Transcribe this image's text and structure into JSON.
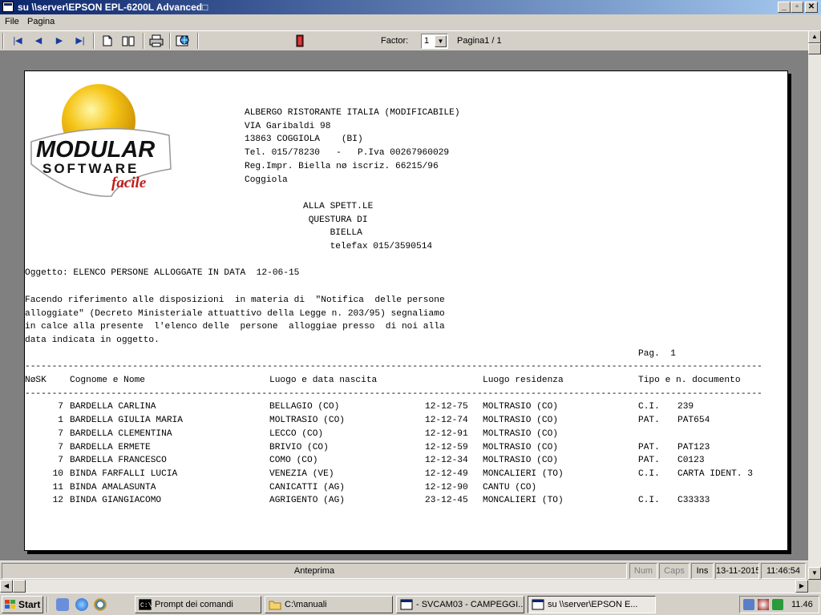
{
  "window": {
    "title": "su \\\\server\\EPSON EPL-6200L Advanced",
    "title_suffix": "□",
    "min_glyph": "_",
    "max_glyph": "▫",
    "close_glyph": "✕"
  },
  "menu": [
    "File",
    "Pagina"
  ],
  "toolbar": {
    "buttons": [
      "first-page",
      "prev-page",
      "next-page",
      "last-page",
      "single-page",
      "two-pages",
      "print",
      "export",
      "exit"
    ],
    "glyphs": {
      "first": "|◀",
      "prev": "◀",
      "next": "▶",
      "last": "▶|"
    },
    "factor_label": "Factor:",
    "factor_value": "1",
    "page_label": "Pagina1 / 1"
  },
  "logo": {
    "line1": "MODULAR",
    "line2": "SOFTWARE",
    "line3": "facile"
  },
  "document": {
    "header_lines": [
      "ALBERGO RISTORANTE ITALIA (MODIFICABILE)",
      "VIA Garibaldi 98",
      "13863 COGGIOLA    (BI)",
      "Tel. 015/78230   -   P.Iva 00267960029",
      "Reg.Impr. Biella nø iscriz. 66215/96",
      "Coggiola"
    ],
    "recipient_lines": [
      "ALLA SPETT.LE",
      " QUESTURA DI",
      "     BIELLA",
      "     telefax 015/3590514"
    ],
    "subject": "Oggetto: ELENCO PERSONE ALLOGGATE IN DATA  12-06-15",
    "body_lines": [
      "Facendo riferimento alle disposizioni  in materia di  \"Notifica  delle persone",
      "alloggiate\" (Decreto Ministeriale attuattivo della Legge n. 203/95) segnaliamo",
      "in calce alla presente  l'elenco delle  persone  alloggiae presso  di noi alla",
      "data indicata in oggetto."
    ],
    "page_number": "Pag.  1",
    "separator": "--------------------------------------------------------------------------------------------------------------------------------------------------------",
    "columns": [
      "NøSK",
      "Cognome e Nome",
      "Luogo e data nascita",
      "Luogo residenza",
      "Tipo e n. documento"
    ],
    "rows": [
      {
        "n": "7",
        "name": "BARDELLA CARLINA",
        "birthplace": "BELLAGIO (CO)",
        "date": "12-12-75",
        "residence": "MOLTRASIO (CO)",
        "doc_type": "C.I.",
        "doc_no": "239"
      },
      {
        "n": "1",
        "name": "BARDELLA GIULIA MARIA",
        "birthplace": "MOLTRASIO (CO)",
        "date": "12-12-74",
        "residence": "MOLTRASIO (CO)",
        "doc_type": "PAT.",
        "doc_no": "PAT654"
      },
      {
        "n": "7",
        "name": "BARDELLA CLEMENTINA",
        "birthplace": "LECCO (CO)",
        "date": "12-12-91",
        "residence": "MOLTRASIO (CO)",
        "doc_type": "",
        "doc_no": ""
      },
      {
        "n": "7",
        "name": "BARDELLA ERMETE",
        "birthplace": "BRIVIO (CO)",
        "date": "12-12-59",
        "residence": "MOLTRASIO (CO)",
        "doc_type": "PAT.",
        "doc_no": "PAT123"
      },
      {
        "n": "7",
        "name": "BARDELLA FRANCESCO",
        "birthplace": "COMO (CO)",
        "date": "12-12-34",
        "residence": "MOLTRASIO (CO)",
        "doc_type": "PAT.",
        "doc_no": "C0123"
      },
      {
        "n": "10",
        "name": "BINDA FARFALLI LUCIA",
        "birthplace": "VENEZIA (VE)",
        "date": "12-12-49",
        "residence": "MONCALIERI (TO)",
        "doc_type": "C.I.",
        "doc_no": "CARTA IDENT. 3"
      },
      {
        "n": "11",
        "name": "BINDA AMALASUNTA",
        "birthplace": "CANICATTI (AG)",
        "date": "12-12-90",
        "residence": "CANTU (CO)",
        "doc_type": "",
        "doc_no": ""
      },
      {
        "n": "12",
        "name": "BINDA GIANGIACOMO",
        "birthplace": "AGRIGENTO (AG)",
        "date": "23-12-45",
        "residence": "MONCALIERI (TO)",
        "doc_type": "C.I.",
        "doc_no": "C33333"
      }
    ]
  },
  "status": {
    "label": "Anteprima",
    "num": "Num",
    "caps": "Caps",
    "ins": "Ins",
    "date": "13-11-2015",
    "time": "11:46:54"
  },
  "taskbar": {
    "start": "Start",
    "tasks": [
      {
        "label": "Prompt dei comandi",
        "active": false
      },
      {
        "label": "C:\\manuali",
        "active": false
      },
      {
        "label": "- SVCAM03 - CAMPEGGI...",
        "active": false
      },
      {
        "label": "su \\\\server\\EPSON E...",
        "active": true
      }
    ],
    "clock": "11.46"
  },
  "colors": {
    "title_active": "#0a246a",
    "title_gradient_end": "#a6caf0",
    "face": "#d4d0c8",
    "viewport_bg": "#808080",
    "logo_sphere": "#f5c518"
  }
}
